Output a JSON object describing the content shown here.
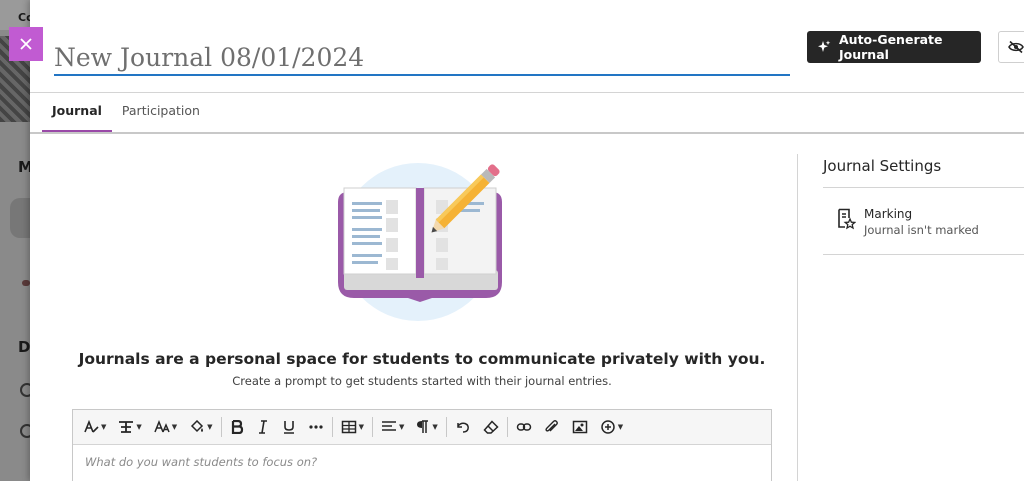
{
  "background": {
    "top_text": "Co",
    "letter_m": "M",
    "letter_d": "D"
  },
  "header": {
    "title_value": "New Journal 08/01/2024",
    "autogen_label": "Auto-Generate Journal"
  },
  "tabs": [
    {
      "label": "Journal",
      "active": true
    },
    {
      "label": "Participation",
      "active": false
    }
  ],
  "empty_state": {
    "title": "Journals are a personal space for students to communicate privately with you.",
    "subtitle": "Create a prompt to get students started with their journal entries."
  },
  "editor": {
    "placeholder": "What do you want students to focus on?",
    "toolbar": [
      "text-style-icon",
      "paragraph-style-icon",
      "font-size-icon",
      "text-color-icon",
      "bold-icon",
      "italic-icon",
      "underline-icon",
      "more-icon",
      "table-icon",
      "align-icon",
      "paragraph-icon",
      "undo-icon",
      "clear-format-icon",
      "link-icon",
      "attachment-icon",
      "image-icon",
      "insert-icon"
    ]
  },
  "settings": {
    "title": "Journal Settings",
    "marking_label": "Marking",
    "marking_value": "Journal isn't marked"
  },
  "colors": {
    "accent": "#c15bd2",
    "tab_underline": "#9a4aa8",
    "title_underline": "#2275c4",
    "button_dark": "#262626"
  }
}
